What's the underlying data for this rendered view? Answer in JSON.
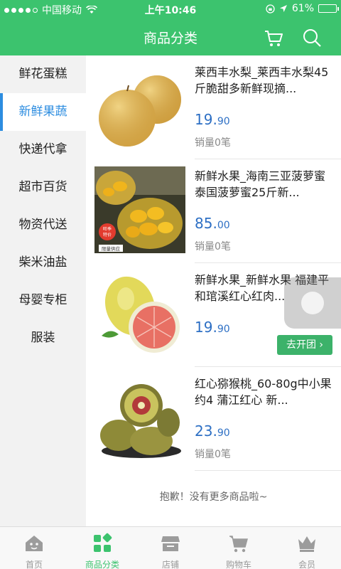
{
  "statusbar": {
    "carrier": "中国移动",
    "time": "上午10:46",
    "battery": "61%",
    "battery_level": 0.61
  },
  "header": {
    "title": "商品分类",
    "icons": [
      "cart-icon",
      "search-icon"
    ]
  },
  "sidebar": {
    "active_index": 1,
    "items": [
      {
        "label": "鲜花蛋糕"
      },
      {
        "label": "新鲜果蔬"
      },
      {
        "label": "快递代拿"
      },
      {
        "label": "超市百货"
      },
      {
        "label": "物资代送"
      },
      {
        "label": "柴米油盐"
      },
      {
        "label": "母婴专柜"
      },
      {
        "label": "服装"
      }
    ]
  },
  "products": [
    {
      "name": "莱西丰水梨_莱西丰水梨45斤脆甜多新鲜现摘...",
      "price_int": "19.",
      "price_dec": "90",
      "sales": "销量0笔"
    },
    {
      "name": "新鲜水果_海南三亚菠萝蜜泰国菠萝蜜25斤新...",
      "price_int": "85.",
      "price_dec": "00",
      "sales": "销量0笔",
      "badge_top": "旺季",
      "badge_bottom": "特价",
      "tag": "限量供应"
    },
    {
      "name": "新鲜水果_新鲜水果 福建平和琯溪红心红肉...",
      "price_int": "19.",
      "price_dec": "90",
      "button": "去开团"
    },
    {
      "name": "红心猕猴桃_60-80g中小果约4 蒲江红心 新...",
      "price_int": "23.",
      "price_dec": "90",
      "sales": "销量0笔"
    }
  ],
  "no_more": "抱歉！没有更多商品啦~",
  "tabbar": {
    "active_index": 1,
    "items": [
      {
        "label": "首页",
        "icon": "home-icon"
      },
      {
        "label": "商品分类",
        "icon": "category-icon"
      },
      {
        "label": "店铺",
        "icon": "store-icon"
      },
      {
        "label": "购物车",
        "icon": "cart-icon"
      },
      {
        "label": "会员",
        "icon": "crown-icon"
      }
    ]
  },
  "colors": {
    "primary": "#3cc36e",
    "accent_blue": "#2d8de0",
    "price": "#2d6fc4"
  }
}
